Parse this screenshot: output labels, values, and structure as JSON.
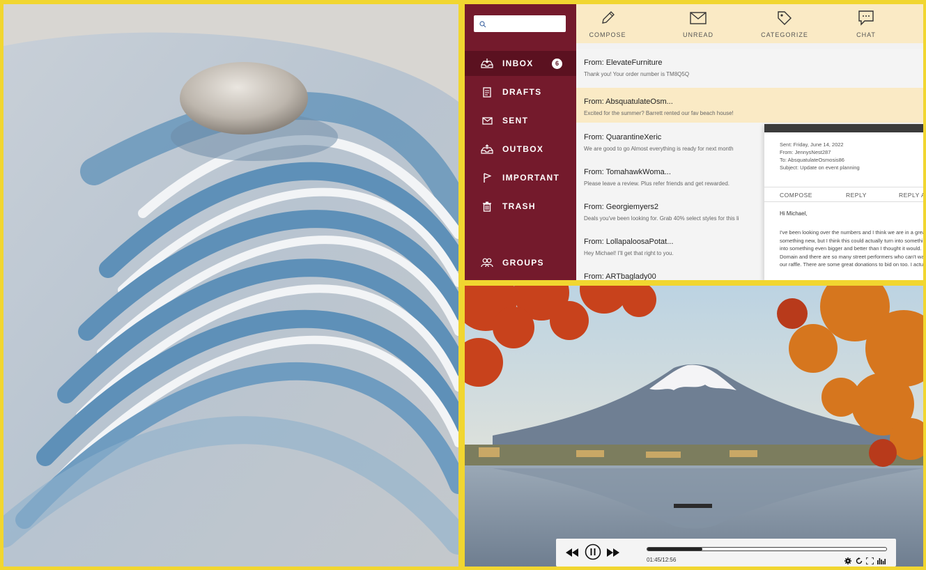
{
  "sidebar": {
    "search_placeholder": "",
    "items": [
      {
        "label": "INBOX",
        "icon": "inbox-icon",
        "badge": "6"
      },
      {
        "label": "DRAFTS",
        "icon": "drafts-icon"
      },
      {
        "label": "SENT",
        "icon": "envelope-icon"
      },
      {
        "label": "OUTBOX",
        "icon": "outbox-icon"
      },
      {
        "label": "IMPORTANT",
        "icon": "flag-icon"
      },
      {
        "label": "TRASH",
        "icon": "trash-icon"
      },
      {
        "label": "GROUPS",
        "icon": "groups-icon"
      }
    ]
  },
  "toolbar": {
    "compose": "COMPOSE",
    "unread": "UNREAD",
    "categorize": "CATEGORIZE",
    "chat": "CHAT"
  },
  "messages": [
    {
      "from": "From: ElevateFurniture",
      "preview": "Thank you! Your order number is TM8Q5Q"
    },
    {
      "from": "From: AbsquatulateOsm...",
      "preview": "Excited for the summer? Barrett rented our fav beach house!"
    },
    {
      "from": "From: QuarantineXeric",
      "preview": "We are good to go Almost everything is ready for next month"
    },
    {
      "from": "From: TomahawkWoma...",
      "preview": "Please leave a review. Plus refer friends and get rewarded."
    },
    {
      "from": "From: Georgiemyers2",
      "preview": "Deals you've been looking for. Grab 40% select styles for this li"
    },
    {
      "from": "From: LollapaloosaPotat...",
      "preview": "Hey Michael! I'll get that right to you."
    },
    {
      "from": "From: ARTbaglady00",
      "preview": ""
    }
  ],
  "reading": {
    "sent": "Sent: Friday, June 14, 2022",
    "from": "From: JennysNest287",
    "to": "To: AbsquatulateOsmosis86",
    "subject": "Subject: Update on event planning",
    "compose": "COMPOSE",
    "reply": "REPLY",
    "reply_all": "REPLY A",
    "greeting": "Hi Michael,",
    "body_lines": [
      "I've been looking over the numbers and I think we are in a great",
      "something new, but I think this could actually turn into somethi",
      "into something even bigger and better than I thought it would.",
      "Domain and there are so many street performers who can't wa",
      "our raffle. There are some great donations to bid on too. I actu"
    ]
  },
  "player": {
    "time": "01:45/12:56",
    "progress": 0.23
  },
  "colors": {
    "frame": "#f1d630",
    "sidebar": "#741a2c",
    "sidebar_active": "#5b1120",
    "toolbar": "#faeac5"
  }
}
